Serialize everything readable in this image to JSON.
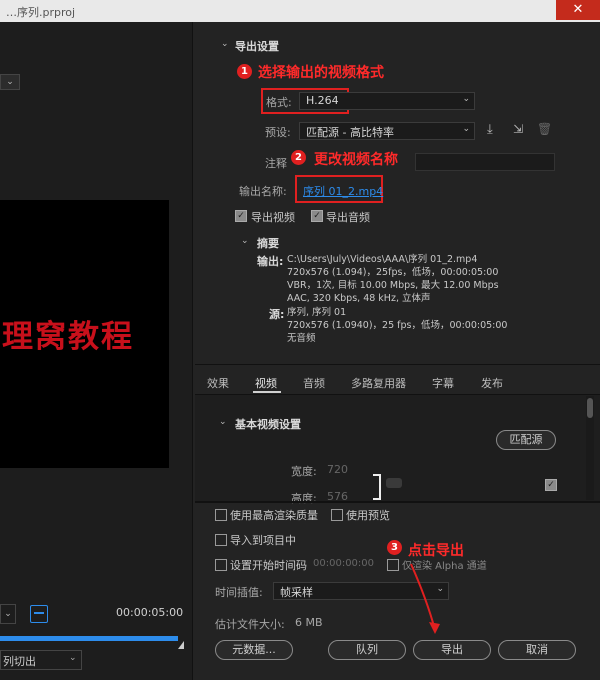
{
  "window": {
    "title": "…序列.prproj",
    "close_glyph": "✕"
  },
  "left": {
    "watermark": "理窝教程",
    "timecode": "00:00:05:00",
    "transition_select": "列切出"
  },
  "export_settings": {
    "section_title": "导出设置",
    "format_label": "格式:",
    "format_value": "H.264",
    "preset_label": "预设:",
    "preset_value": "匹配源 - 高比特率",
    "comment_label": "注释",
    "output_name_label": "输出名称:",
    "output_name_value": "序列 01_2.mp4",
    "export_video_label": "导出视频",
    "export_audio_label": "导出音频"
  },
  "annotations": {
    "a1_num": "1",
    "a1_text": "选择输出的视频格式",
    "a2_num": "2",
    "a2_text": "更改视频名称",
    "a3_num": "3",
    "a3_text": "点击导出"
  },
  "summary": {
    "title": "摘要",
    "output_label": "输出:",
    "output_lines": [
      "C:\\Users\\July\\Videos\\AAA\\序列 01_2.mp4",
      "720x576 (1.094)，25fps，低场，00:00:05:00",
      "VBR，1次, 目标 10.00 Mbps, 最大 12.00 Mbps",
      "AAC, 320 Kbps, 48  kHz, 立体声"
    ],
    "source_label": "源:",
    "source_lines": [
      "序列, 序列 01",
      "720x576 (1.0940)，25 fps，低场，00:00:05:00",
      "无音频"
    ]
  },
  "tabs": [
    "效果",
    "视频",
    "音频",
    "多路复用器",
    "字幕",
    "发布"
  ],
  "active_tab": "视频",
  "video_settings": {
    "title": "基本视频设置",
    "match_source_button": "匹配源",
    "width_label": "宽度:",
    "width_value": "720",
    "height_label": "高度:",
    "height_value": "576"
  },
  "bottom": {
    "max_render_quality": "使用最高渲染质量",
    "use_previews": "使用预览",
    "import_into_project": "导入到项目中",
    "set_start_timecode": "设置开始时间码",
    "start_timecode_value": "00:00:00:00",
    "render_alpha_only": "仅渲染 Alpha 通道",
    "time_interp_label": "时间插值:",
    "time_interp_value": "帧采样",
    "est_file_size_label": "估计文件大小:",
    "est_file_size_value": "6 MB",
    "metadata_button": "元数据...",
    "queue_button": "队列",
    "export_button": "导出",
    "cancel_button": "取消"
  },
  "colors": {
    "annotation_red": "#e02020",
    "accent_blue": "#2d8ceb"
  }
}
